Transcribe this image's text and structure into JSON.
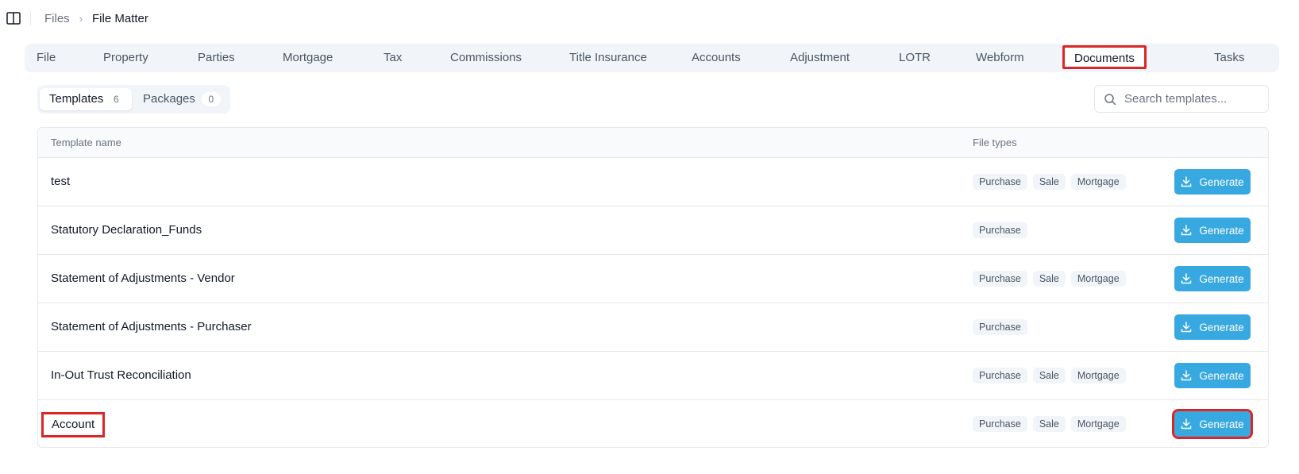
{
  "breadcrumb": {
    "root": "Files",
    "separator": "›",
    "current": "File Matter"
  },
  "tabs": [
    {
      "label": "File"
    },
    {
      "label": "Property"
    },
    {
      "label": "Parties"
    },
    {
      "label": "Mortgage"
    },
    {
      "label": "Tax"
    },
    {
      "label": "Commissions"
    },
    {
      "label": "Title Insurance"
    },
    {
      "label": "Accounts"
    },
    {
      "label": "Adjustment"
    },
    {
      "label": "LOTR"
    },
    {
      "label": "Webform"
    },
    {
      "label": "Documents"
    },
    {
      "label": "Tasks"
    }
  ],
  "active_tab": "Documents",
  "subtabs": [
    {
      "label": "Templates",
      "count": "6"
    },
    {
      "label": "Packages",
      "count": "0"
    }
  ],
  "search": {
    "placeholder": "Search templates..."
  },
  "table": {
    "headers": {
      "name": "Template name",
      "types": "File types"
    },
    "generate_label": "Generate",
    "rows": [
      {
        "name": "test",
        "types": [
          "Purchase",
          "Sale",
          "Mortgage"
        ]
      },
      {
        "name": "Statutory Declaration_Funds",
        "types": [
          "Purchase"
        ]
      },
      {
        "name": "Statement of Adjustments - Vendor",
        "types": [
          "Purchase",
          "Sale",
          "Mortgage"
        ]
      },
      {
        "name": "Statement of Adjustments - Purchaser",
        "types": [
          "Purchase"
        ]
      },
      {
        "name": "In-Out Trust Reconciliation",
        "types": [
          "Purchase",
          "Sale",
          "Mortgage"
        ]
      },
      {
        "name": "Account",
        "types": [
          "Purchase",
          "Sale",
          "Mortgage"
        ]
      }
    ]
  },
  "colors": {
    "accent": "#38a9e0",
    "highlight": "#dc2626",
    "tab_bg": "#f1f5f9"
  }
}
